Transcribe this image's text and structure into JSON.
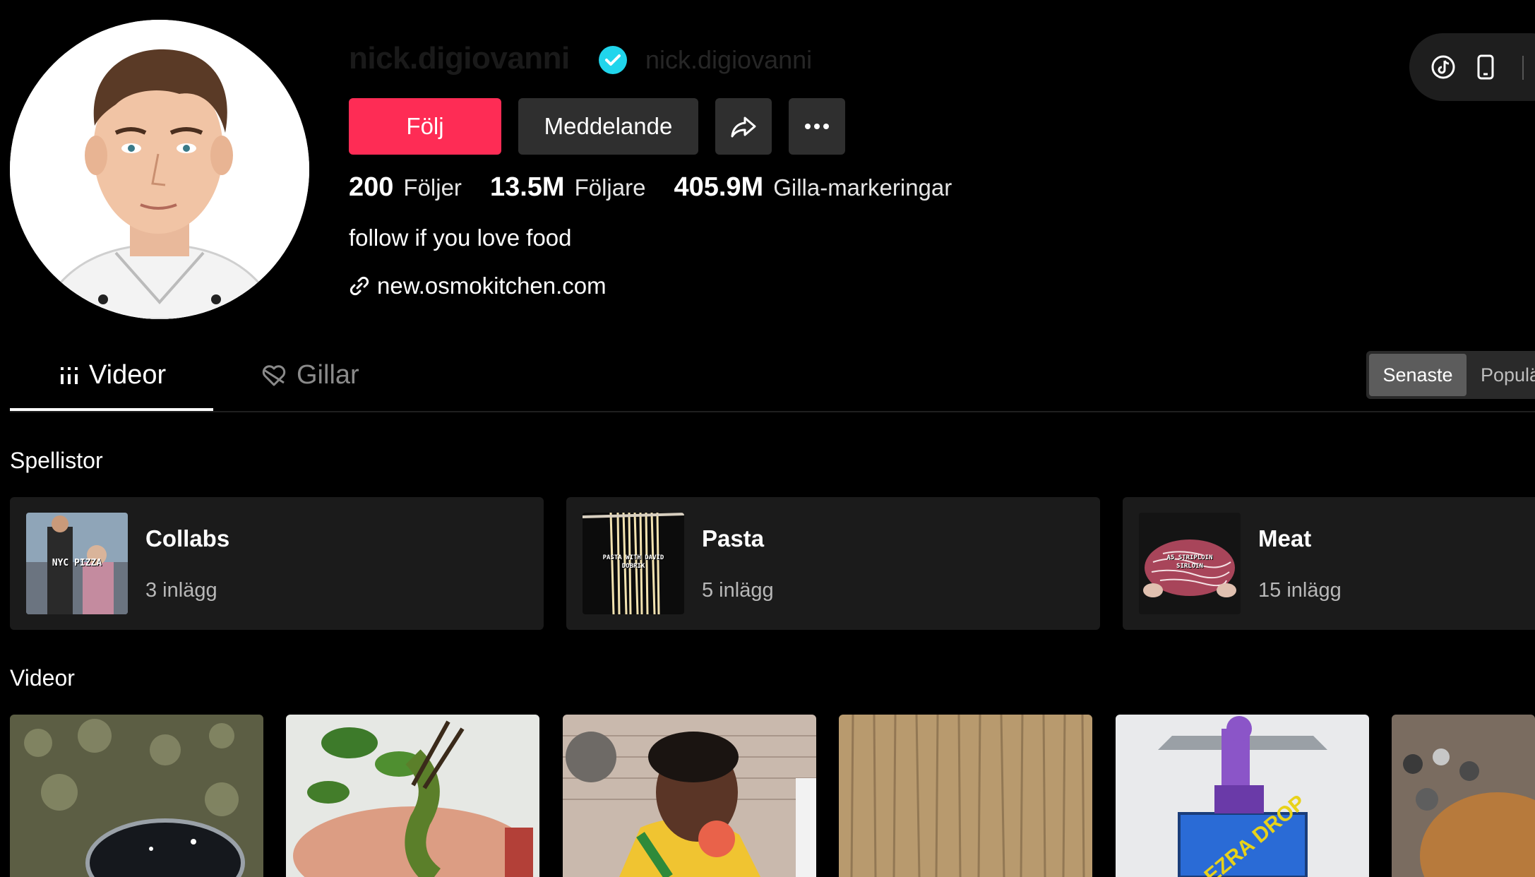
{
  "profile": {
    "username": "nick.digiovanni",
    "nickname": "nick.digiovanni",
    "verified": true,
    "bio": "follow if you love food",
    "link": "new.osmokitchen.com"
  },
  "actions": {
    "follow": "Följ",
    "message": "Meddelande",
    "share_icon": "share-icon",
    "more_icon": "more-icon"
  },
  "stats": [
    {
      "value": "200",
      "label": "Följer"
    },
    {
      "value": "13.5M",
      "label": "Följare"
    },
    {
      "value": "405.9M",
      "label": "Gilla-markeringar"
    }
  ],
  "tabs": [
    {
      "label": "Videor",
      "icon": "grid-icon",
      "active": true
    },
    {
      "label": "Gillar",
      "icon": "heart-icon",
      "active": false
    }
  ],
  "sort": {
    "active": "Senaste",
    "other": "Populärt"
  },
  "playlists_title": "Spellistor",
  "playlists": [
    {
      "name": "Collabs",
      "count": "3 inlägg",
      "thumb_text": "NYC PIZZA"
    },
    {
      "name": "Pasta",
      "count": "5 inlägg",
      "thumb_text": "PASTA WITH DAVID DOBRIK"
    },
    {
      "name": "Meat",
      "count": "15 inlägg",
      "thumb_text": "A5 STRIPLOIN SIRLOIN"
    }
  ],
  "videos_title": "Videor",
  "videos": [
    {
      "thumb_text": ""
    },
    {
      "thumb_text": ""
    },
    {
      "thumb_text": ""
    },
    {
      "thumb_text": ""
    },
    {
      "thumb_text": "EZRA DROP"
    },
    {
      "thumb_text": ""
    }
  ],
  "colors": {
    "accent": "#fe2c55",
    "verified": "#20d5ec",
    "background": "#000000"
  }
}
